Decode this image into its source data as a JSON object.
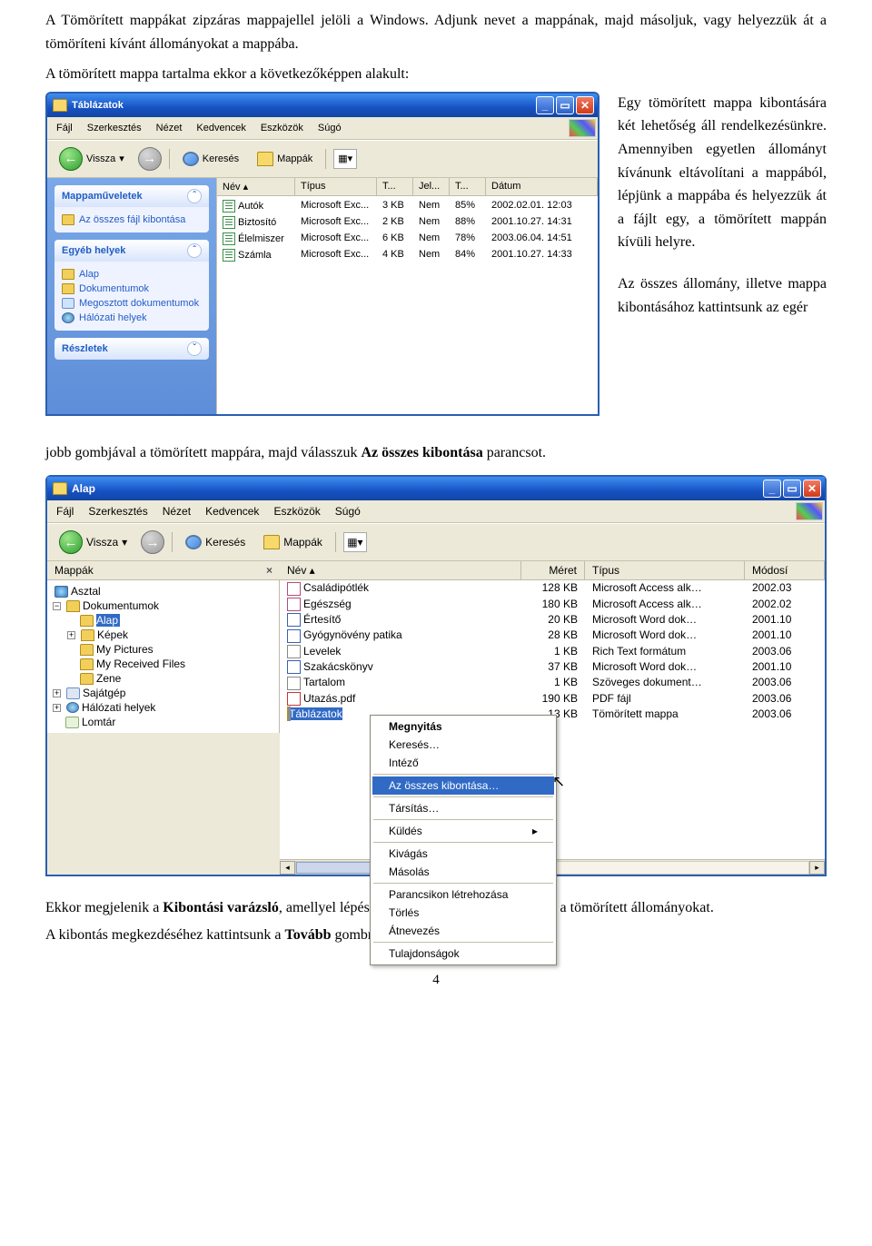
{
  "text": {
    "p1a": "A Tömörített mappákat zipzáras mappajellel jelöli a Windows. Adjunk nevet a mappának, majd másoljuk, vagy helyezzük át a tömöríteni kívánt állományokat a mappába.",
    "p1b": "A tömörített mappa tartalma ekkor a következőképpen alakult:",
    "side1": "Egy tömörített mappa kibontására két lehetőség áll rendelkezésünkre. Amennyiben egyetlen állományt kívánunk eltávolítani a mappából, lépjünk a mappába és helyezzük át a fájlt egy, a tömörített mappán kívüli helyre.",
    "side2a": "Az összes állomány, illetve mappa kibontásához kattintsunk az egér",
    "p2a": "jobb gombjával a tömörített mappára, majd válasszuk ",
    "p2b": "Az összes kibontása",
    "p2c": " parancsot.",
    "p3a": "Ekkor megjelenik a ",
    "p3b": "Kibontási varázsló",
    "p3c": ", amellyel lépésről lépésre haladva kibonthatjuk a tömörített állományokat.",
    "p4a": "A kibontás megkezdéséhez kattintsunk a ",
    "p4b": "Tovább",
    "p4c": " gombra.",
    "page_number": "4"
  },
  "win1": {
    "title": "Táblázatok",
    "menu": [
      "Fájl",
      "Szerkesztés",
      "Nézet",
      "Kedvencek",
      "Eszközök",
      "Súgó"
    ],
    "toolbar": {
      "back": "Vissza",
      "search": "Keresés",
      "folders": "Mappák"
    },
    "cols": [
      "Név",
      "Típus",
      "T...",
      "Jel...",
      "T...",
      "Dátum"
    ],
    "rows": [
      {
        "n": "Autók",
        "t": "Microsoft Exc...",
        "s": "3 KB",
        "j": "Nem",
        "p": "85%",
        "d": "2002.02.01. 12:03"
      },
      {
        "n": "Biztosító",
        "t": "Microsoft Exc...",
        "s": "2 KB",
        "j": "Nem",
        "p": "88%",
        "d": "2001.10.27. 14:31"
      },
      {
        "n": "Élelmiszer",
        "t": "Microsoft Exc...",
        "s": "6 KB",
        "j": "Nem",
        "p": "78%",
        "d": "2003.06.04. 14:51"
      },
      {
        "n": "Számla",
        "t": "Microsoft Exc...",
        "s": "4 KB",
        "j": "Nem",
        "p": "84%",
        "d": "2001.10.27. 14:33"
      }
    ],
    "panels": {
      "p1_title": "Mappaműveletek",
      "p1_item": "Az összes fájl kibontása",
      "p2_title": "Egyéb helyek",
      "p2_items": [
        "Alap",
        "Dokumentumok",
        "Megosztott dokumentumok",
        "Hálózati helyek"
      ],
      "p3_title": "Részletek"
    }
  },
  "win2": {
    "title": "Alap",
    "menu": [
      "Fájl",
      "Szerkesztés",
      "Nézet",
      "Kedvencek",
      "Eszközök",
      "Súgó"
    ],
    "toolbar": {
      "back": "Vissza",
      "search": "Keresés",
      "folders": "Mappák"
    },
    "tree_title": "Mappák",
    "tree": {
      "asztal": "Asztal",
      "dokumentumok": "Dokumentumok",
      "alap": "Alap",
      "kepek": "Képek",
      "mypic": "My Pictures",
      "myrec": "My Received Files",
      "zene": "Zene",
      "sajatgep": "Sajátgép",
      "halo": "Hálózati helyek",
      "lomtar": "Lomtár"
    },
    "cols": [
      "Név",
      "Méret",
      "Típus",
      "Módosí"
    ],
    "rows": [
      {
        "ic": "acc",
        "n": "Családipótlék",
        "s": "128 KB",
        "t": "Microsoft Access alk…",
        "d": "2002.03"
      },
      {
        "ic": "acc",
        "n": "Egészség",
        "s": "180 KB",
        "t": "Microsoft Access alk…",
        "d": "2002.02"
      },
      {
        "ic": "wrd",
        "n": "Értesítő",
        "s": "20 KB",
        "t": "Microsoft Word dok…",
        "d": "2001.10"
      },
      {
        "ic": "wrd",
        "n": "Gyógynövény patika",
        "s": "28 KB",
        "t": "Microsoft Word dok…",
        "d": "2001.10"
      },
      {
        "ic": "txt",
        "n": "Levelek",
        "s": "1 KB",
        "t": "Rich Text formátum",
        "d": "2003.06"
      },
      {
        "ic": "wrd",
        "n": "Szakácskönyv",
        "s": "37 KB",
        "t": "Microsoft Word dok…",
        "d": "2001.10"
      },
      {
        "ic": "txt",
        "n": "Tartalom",
        "s": "1 KB",
        "t": "Szöveges dokument…",
        "d": "2003.06"
      },
      {
        "ic": "pdf",
        "n": "Utazás.pdf",
        "s": "190 KB",
        "t": "PDF fájl",
        "d": "2003.06"
      },
      {
        "ic": "zip",
        "n": "Táblázatok",
        "s": "13 KB",
        "t": "Tömörített mappa",
        "d": "2003.06",
        "sel": true
      }
    ],
    "context_menu": {
      "items": [
        {
          "label": "Megnyitás",
          "bold": true
        },
        {
          "label": "Keresés…"
        },
        {
          "label": "Intéző"
        },
        {
          "sep": true
        },
        {
          "label": "Az összes kibontása…",
          "hi": true
        },
        {
          "sep": true
        },
        {
          "label": "Társítás…"
        },
        {
          "sep": true
        },
        {
          "label": "Küldés",
          "arrow": true
        },
        {
          "sep": true
        },
        {
          "label": "Kivágás"
        },
        {
          "label": "Másolás"
        },
        {
          "sep": true
        },
        {
          "label": "Parancsikon létrehozása"
        },
        {
          "label": "Törlés"
        },
        {
          "label": "Átnevezés"
        },
        {
          "sep": true
        },
        {
          "label": "Tulajdonságok"
        }
      ]
    }
  }
}
